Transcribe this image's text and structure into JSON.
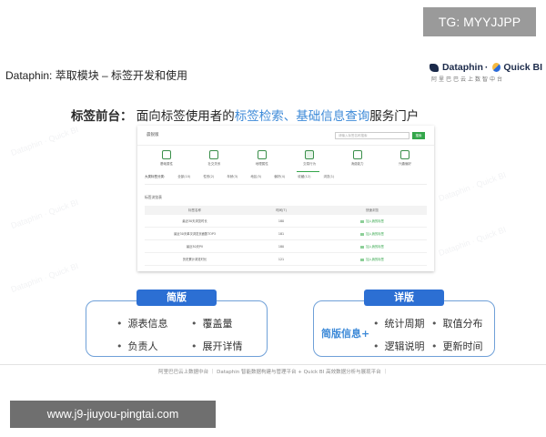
{
  "overlay": {
    "tg_badge": "TG: MYYJJPP",
    "url_badge": "www.j9-jiuyou-pingtai.com"
  },
  "slide": {
    "title": "Dataphin: 萃取模块 – 标签开发和使用",
    "logo_name": "Dataphin",
    "logo_sep": "·",
    "logo_name2": "Quick BI",
    "logo_sub": "阿里巴巴云上数智中台",
    "headline": {
      "label": "标签前台：",
      "text_before": "面向标签使用者的",
      "highlight": "标签检索、基础信息查询",
      "text_after": "服务门户"
    },
    "footer": "阿里巴巴云上数据中台 ｜ Dataphin 智能数据构建与管理平台 + Quick BI 高效数据分析与展现平台 ｜"
  },
  "mock": {
    "brand": "晨锐版",
    "search_placeholder": "请输入标签名称搜索",
    "search_button": "搜索",
    "categories": [
      {
        "label": "基础属性",
        "icon": "user-profile-icon"
      },
      {
        "label": "社交关系",
        "icon": "people-icon"
      },
      {
        "label": "地理属性",
        "icon": "location-icon"
      },
      {
        "label": "交易行为",
        "icon": "trade-icon"
      },
      {
        "label": "消费能力",
        "icon": "consumption-icon"
      },
      {
        "label": "兴趣偏好",
        "icon": "heart-icon"
      }
    ],
    "filters": [
      "大类标签分类: ",
      "全部(10)",
      "性别(2)",
      "年龄(3)",
      "地区(5)",
      "偏好(4)",
      "收藏(12)",
      "浏览(1)"
    ],
    "section_title": "标签浏览表",
    "table_headers": [
      "标签名称",
      "时间(T)",
      "快速浏览"
    ],
    "table_rows": [
      {
        "name": "最近30天浏览时长",
        "time": "180",
        "action": "加入我的标签"
      },
      {
        "name": "最近30天单次浏览页面数TOP3",
        "time": "181",
        "action": "加入我的标签"
      },
      {
        "name": "最近30天PV",
        "time": "180",
        "action": "加入我的标签"
      },
      {
        "name": "历史累计浏览时长",
        "time": "121",
        "action": "加入我的标签"
      }
    ]
  },
  "simple": {
    "tab": "简版",
    "items": [
      "源表信息",
      "覆盖量",
      "负责人",
      "展开详情"
    ]
  },
  "detail": {
    "tab": "详版",
    "prefix": "简版信息+",
    "items": [
      "统计周期",
      "取值分布",
      "逻辑说明",
      "更新时间"
    ]
  },
  "colors": {
    "accent_blue": "#2c6fd3",
    "highlight_blue": "#3d8ad8",
    "mock_green": "#33a64a"
  }
}
